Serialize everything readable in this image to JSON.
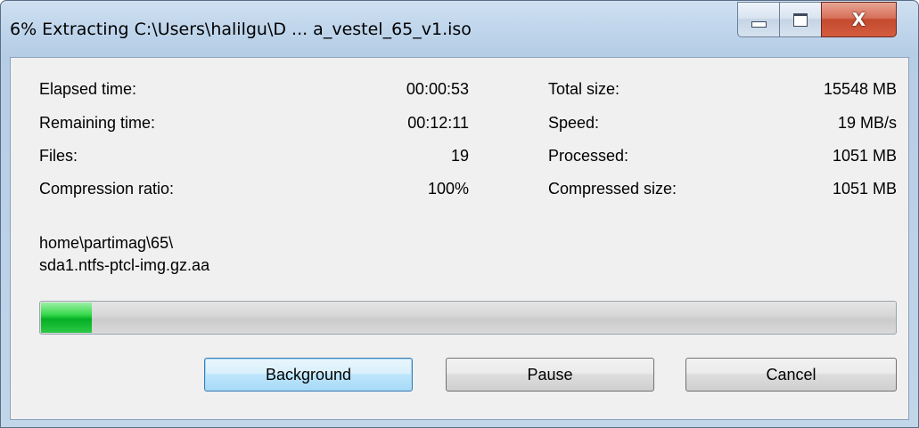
{
  "window": {
    "title": "6% Extracting C:\\Users\\halilgu\\D ... a_vestel_65_v1.iso",
    "close_glyph": "X"
  },
  "stats": {
    "left": [
      {
        "label": "Elapsed time:",
        "value": "00:00:53"
      },
      {
        "label": "Remaining time:",
        "value": "00:12:11"
      },
      {
        "label": "Files:",
        "value": "19"
      },
      {
        "label": "Compression ratio:",
        "value": "100%"
      }
    ],
    "right": [
      {
        "label": "Total size:",
        "value": "15548 MB"
      },
      {
        "label": "Speed:",
        "value": "19 MB/s"
      },
      {
        "label": "Processed:",
        "value": "1051 MB"
      },
      {
        "label": "Compressed size:",
        "value": "1051 MB"
      }
    ]
  },
  "current_file": {
    "line1": "home\\partimag\\65\\",
    "line2": "sda1.ntfs-ptcl-img.gz.aa"
  },
  "progress": {
    "percent": 6,
    "fill_color": "#06b025"
  },
  "buttons": {
    "background": "Background",
    "pause": "Pause",
    "cancel": "Cancel"
  },
  "icons": {
    "minimize": "minimize-icon",
    "maximize": "maximize-icon",
    "close": "close-icon"
  }
}
